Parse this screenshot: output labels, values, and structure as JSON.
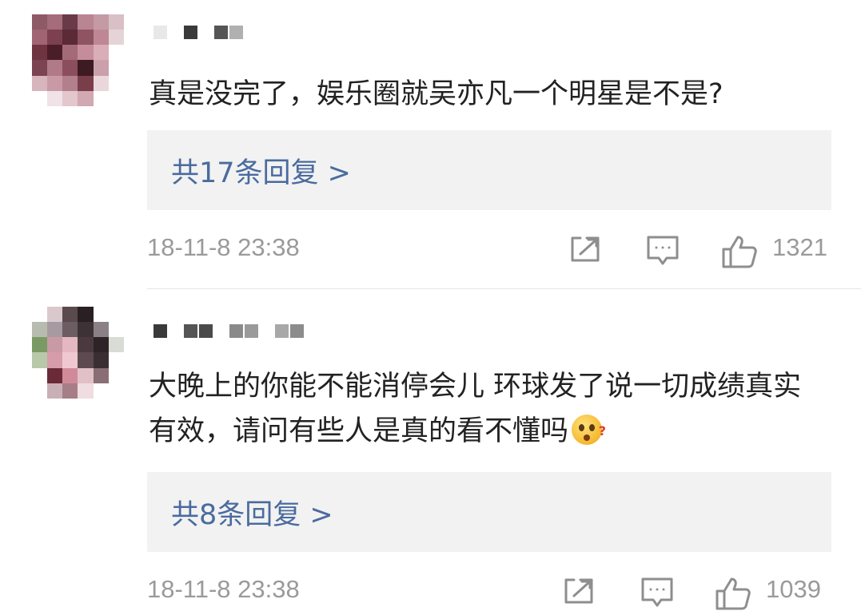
{
  "comments": [
    {
      "text": "真是没完了，娱乐圈就吴亦凡一个明星是不是?",
      "replies_label": "共17条回复 >",
      "timestamp": "18-11-8 23:38",
      "likes": "1321",
      "icons": [
        "share-icon",
        "comment-icon",
        "like-icon"
      ],
      "avatar_colors": [
        "#8e5a66",
        "#a56c7a",
        "#6a3a48",
        "#b98592",
        "#c49aa5",
        "#d8c0c6",
        "#a06472",
        "#7d4050",
        "#5a2a36",
        "#8f5462",
        "#bf8795",
        "#e4d4d8",
        "#6e3440",
        "#4a1e28",
        "#a56a78",
        "#c58c99",
        "#d9aeb8",
        "#ffffff",
        "#7b4452",
        "#b07a87",
        "#8b4e5c",
        "#3e1a22",
        "#caa0aa",
        "#ffffff",
        "#d8b4bc",
        "#c99aa5",
        "#b2808c",
        "#7a3e4b",
        "#e9d7dc",
        "#ffffff",
        "#ffffff",
        "#f0e2e6",
        "#e4c6cd",
        "#d2a8b2",
        "#ffffff",
        "#ffffff"
      ],
      "username_colors": [
        "#e8e8e8",
        "#ffffff",
        "#3a3a3a",
        "#ffffff",
        "#555555",
        "#b0b0b0"
      ]
    },
    {
      "text": "大晚上的你能不能消停会儿 环球发了说一切成绩真实有效，请问有些人是真的看不懂吗",
      "emoji": "?",
      "replies_label": "共8条回复 >",
      "timestamp": "18-11-8 23:38",
      "likes": "1039",
      "icons": [
        "share-icon",
        "comment-icon",
        "like-icon"
      ],
      "avatar_colors": [
        "#ffffff",
        "#d9c9cc",
        "#5a4a4e",
        "#2a2024",
        "#ffffff",
        "#ffffff",
        "#b8bcb0",
        "#a79aa0",
        "#6b5d62",
        "#3d3236",
        "#8a8086",
        "#ffffff",
        "#7a9a64",
        "#c89aa6",
        "#e4b7c2",
        "#4a3a40",
        "#2e2428",
        "#d8dcd4",
        "#b7c9a8",
        "#d69caa",
        "#f0c8d2",
        "#5d4a50",
        "#3a2e32",
        "#ffffff",
        "#ffffff",
        "#6b2a38",
        "#d18a9a",
        "#e2c0c8",
        "#8a6e76",
        "#ffffff",
        "#ffffff",
        "#c9b0b6",
        "#a67e88",
        "#efdde1",
        "#ffffff",
        "#ffffff"
      ],
      "username_colors": [
        "#3a3a3a",
        "#ffffff",
        "#555555",
        "#4a4a4a",
        "#ffffff",
        "#8a8a8a",
        "#9a9a9a",
        "#ffffff",
        "#a8a8a8",
        "#8c8c8c"
      ]
    }
  ],
  "colors": {
    "reply_link": "#4a6b9e",
    "meta_gray": "#9a9a9a",
    "text": "#222222",
    "reply_bg": "#f2f2f2"
  }
}
